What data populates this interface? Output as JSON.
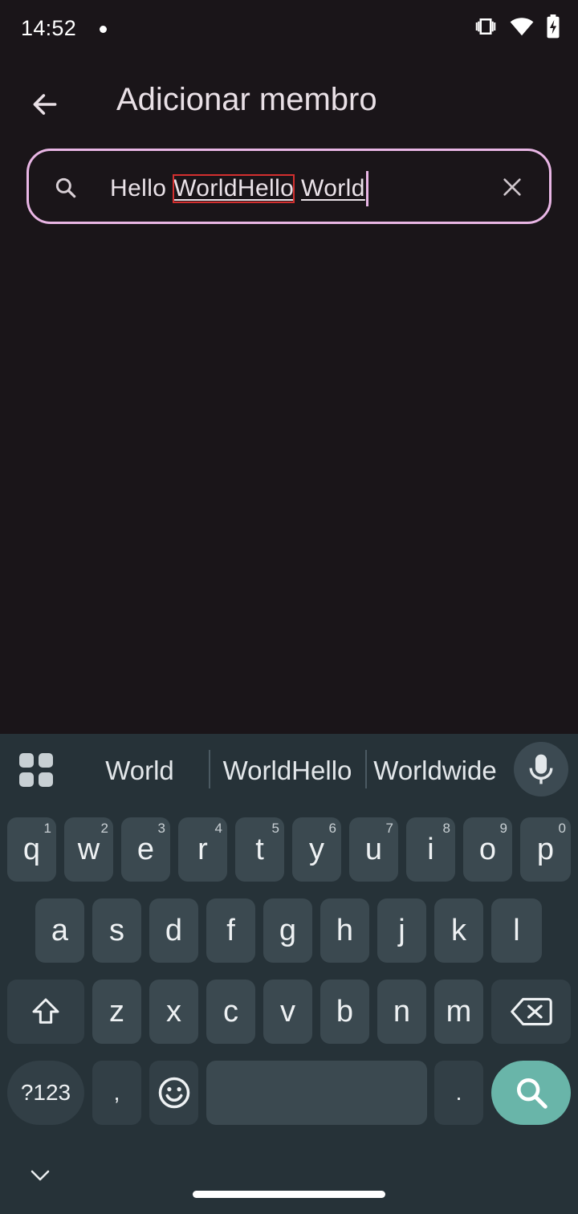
{
  "status_bar": {
    "time": "14:52",
    "icons": [
      "notification-dot",
      "vibrate-icon",
      "wifi-icon",
      "battery-charging-icon"
    ]
  },
  "app_bar": {
    "title": "Adicionar membro"
  },
  "search": {
    "value_parts": [
      "Hello ",
      "WorldHello",
      " ",
      "World"
    ],
    "highlighted_part": "WorldHello",
    "border_color": "#e9b6e5"
  },
  "keyboard": {
    "suggestions": [
      "World",
      "WorldHello",
      "Worldwide"
    ],
    "rows": {
      "row1": [
        {
          "label": "q",
          "hint": "1"
        },
        {
          "label": "w",
          "hint": "2"
        },
        {
          "label": "e",
          "hint": "3"
        },
        {
          "label": "r",
          "hint": "4"
        },
        {
          "label": "t",
          "hint": "5"
        },
        {
          "label": "y",
          "hint": "6"
        },
        {
          "label": "u",
          "hint": "7"
        },
        {
          "label": "i",
          "hint": "8"
        },
        {
          "label": "o",
          "hint": "9"
        },
        {
          "label": "p",
          "hint": "0"
        }
      ],
      "row2": [
        "a",
        "s",
        "d",
        "f",
        "g",
        "h",
        "j",
        "k",
        "l"
      ],
      "row3": [
        "z",
        "x",
        "c",
        "v",
        "b",
        "n",
        "m"
      ],
      "row4": {
        "symbols": "?123",
        "comma": ",",
        "period": "."
      }
    },
    "accent_color": "#69b5a9"
  }
}
